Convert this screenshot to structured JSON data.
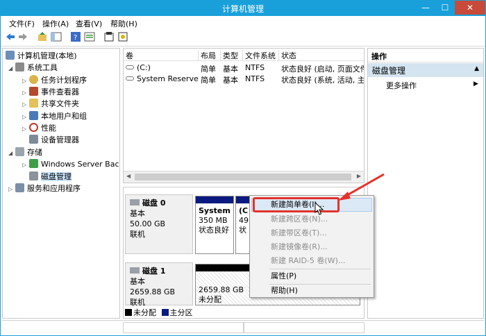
{
  "window": {
    "title": "计算机管理",
    "minimize": "—",
    "maximize": "☐",
    "close": "✕"
  },
  "menu": [
    "文件(F)",
    "操作(A)",
    "查看(V)",
    "帮助(H)"
  ],
  "toolbar": {
    "icons": [
      "back-icon",
      "forward-icon",
      "up-folder-icon",
      "show-tree-icon",
      "help-icon",
      "properties-icon",
      "refresh-icon",
      "export-icon"
    ]
  },
  "tree": {
    "root": "计算机管理(本地)",
    "items": [
      {
        "label": "系统工具",
        "level": 1,
        "expanded": true
      },
      {
        "label": "任务计划程序",
        "level": 2
      },
      {
        "label": "事件查看器",
        "level": 2
      },
      {
        "label": "共享文件夹",
        "level": 2
      },
      {
        "label": "本地用户和组",
        "level": 2
      },
      {
        "label": "性能",
        "level": 2
      },
      {
        "label": "设备管理器",
        "level": 2
      },
      {
        "label": "存储",
        "level": 1,
        "expanded": true
      },
      {
        "label": "Windows Server Back",
        "level": 2
      },
      {
        "label": "磁盘管理",
        "level": 2,
        "selected": true
      },
      {
        "label": "服务和应用程序",
        "level": 1
      }
    ]
  },
  "volumes": {
    "columns": [
      "卷",
      "布局",
      "类型",
      "文件系统",
      "状态"
    ],
    "rows": [
      {
        "name": "(C:)",
        "layout": "简单",
        "type": "基本",
        "fs": "NTFS",
        "status": "状态良好 (启动, 页面文件"
      },
      {
        "name": "System Reserved",
        "layout": "简单",
        "type": "基本",
        "fs": "NTFS",
        "status": "状态良好 (系统, 活动, 主分"
      }
    ]
  },
  "disks": [
    {
      "name": "磁盘 0",
      "type": "基本",
      "size": "50.00 GB",
      "state": "联机",
      "partitions": [
        {
          "name": "System",
          "size": "350 MB",
          "status": "状态良好"
        },
        {
          "name": "(C",
          "size": "49.",
          "status": "状"
        }
      ]
    },
    {
      "name": "磁盘 1",
      "type": "基本",
      "size": "2659.88 GB",
      "state": "联机",
      "partitions": [
        {
          "size": "2659.88 GB",
          "status": "未分配"
        }
      ]
    }
  ],
  "legend": [
    {
      "label": "未分配",
      "color": "#000000"
    },
    {
      "label": "主分区",
      "color": "#0a1a80"
    }
  ],
  "actions": {
    "header": "操作",
    "section": "磁盘管理",
    "more": "更多操作"
  },
  "context_menu": [
    {
      "label": "新建简单卷(I)...",
      "enabled": true,
      "highlighted": true
    },
    {
      "label": "新建跨区卷(N)...",
      "enabled": false
    },
    {
      "label": "新建带区卷(T)...",
      "enabled": false
    },
    {
      "label": "新建镜像卷(R)...",
      "enabled": false
    },
    {
      "label": "新建 RAID-5 卷(W)...",
      "enabled": false
    },
    {
      "label": "属性(P)",
      "enabled": true
    },
    {
      "label": "帮助(H)",
      "enabled": true
    }
  ],
  "colors": {
    "titlebar": "#19a0da",
    "primary_partition": "#0a1a80",
    "unallocated": "#000000",
    "annotation": "#e3322b"
  }
}
